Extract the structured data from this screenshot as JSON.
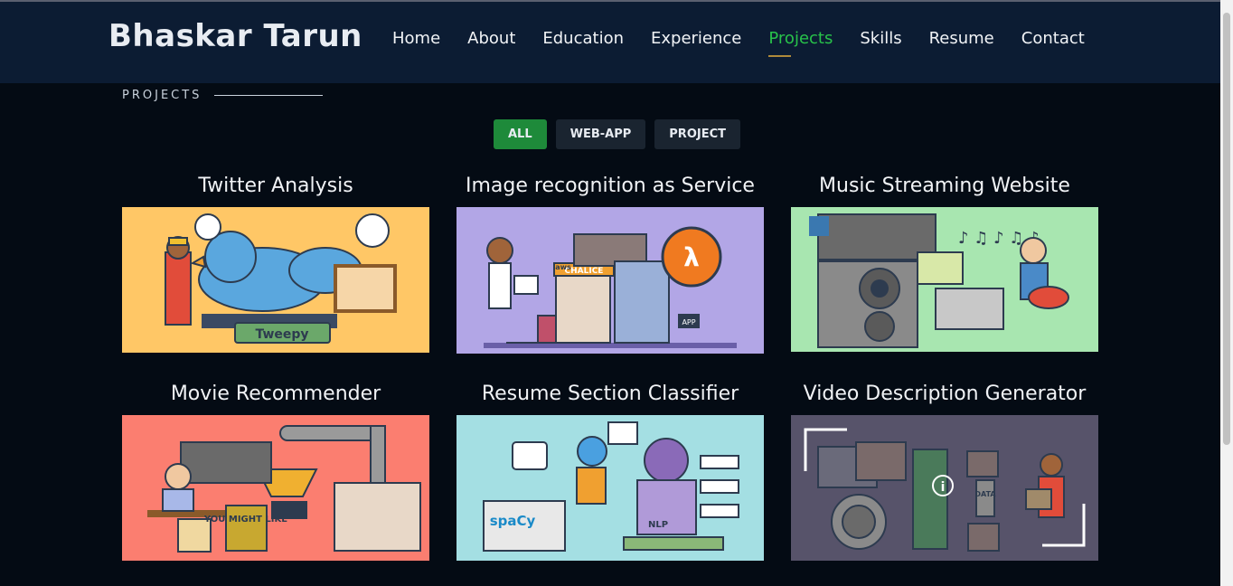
{
  "header": {
    "logo": "Bhaskar Tarun",
    "nav": [
      "Home",
      "About",
      "Education",
      "Experience",
      "Projects",
      "Skills",
      "Resume",
      "Contact"
    ],
    "active_nav": "Projects"
  },
  "section": {
    "title": "PROJECTS"
  },
  "filters": {
    "items": [
      "ALL",
      "WEB-APP",
      "PROJECT"
    ],
    "active": "ALL"
  },
  "projects": [
    {
      "title": "Twitter Analysis",
      "bg": "#ffc766",
      "label": "Tweepy"
    },
    {
      "title": "Image recognition as Service",
      "bg": "#b2a6e6",
      "label": "CHALICE",
      "label2": "aws",
      "label3": "APP"
    },
    {
      "title": "Music Streaming Website",
      "bg": "#a8e6b0"
    },
    {
      "title": "Movie Recommender",
      "bg": "#fb7e70",
      "label": "YOU MIGHT LIKE"
    },
    {
      "title": "Resume Section Classifier",
      "bg": "#a4dfe3",
      "label": "spaCy",
      "label2": "NLP"
    },
    {
      "title": "Video Description Generator",
      "bg": "#57536a",
      "label": "DATA"
    }
  ],
  "colors": {
    "accent": "#28c24a",
    "header_bg": "#0c1c33",
    "page_bg": "#040b14",
    "filter_active": "#1e8a3a"
  }
}
